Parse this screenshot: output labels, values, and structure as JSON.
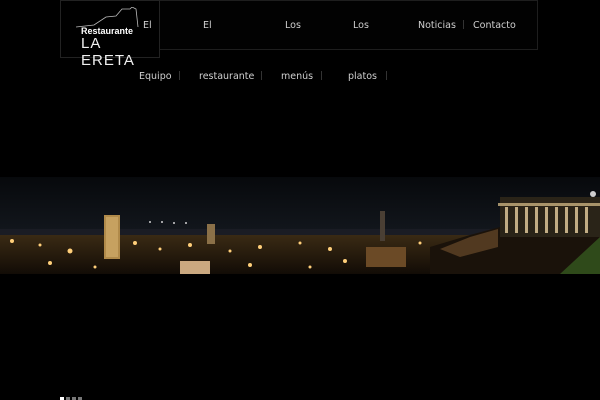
{
  "logo": {
    "small_text": "Restaurante",
    "big_text": "LA ERETA"
  },
  "nav": {
    "top": [
      "El",
      "El",
      "Los",
      "Los",
      "Noticias",
      "Contacto"
    ],
    "bottom": [
      "Equipo",
      "restaurante",
      "menús",
      "platos"
    ]
  },
  "hero": {
    "image_subject": "night panorama of city lights"
  },
  "colors": {
    "background": "#000000",
    "nav_text": "#cfcfcf",
    "separator": "#444444"
  },
  "slider": {
    "count": 4,
    "active_index": 0
  }
}
